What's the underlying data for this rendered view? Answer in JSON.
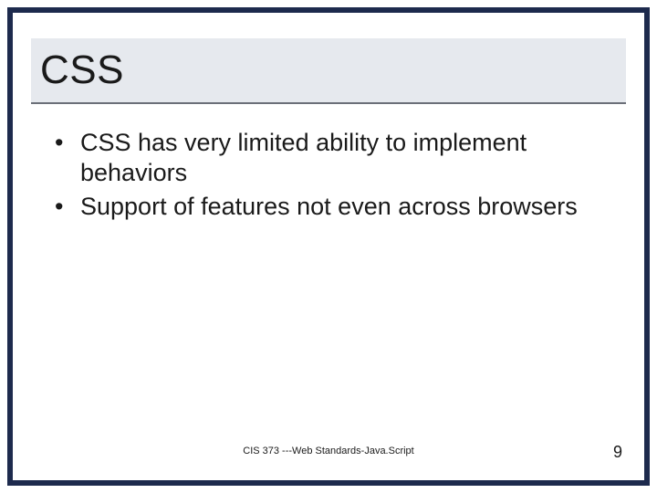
{
  "slide": {
    "title": "CSS",
    "bullets": [
      "CSS has very limited ability to implement behaviors",
      "Support of features not even across browsers"
    ],
    "footer": "CIS 373 ---Web Standards-Java.Script",
    "page_number": "9"
  }
}
